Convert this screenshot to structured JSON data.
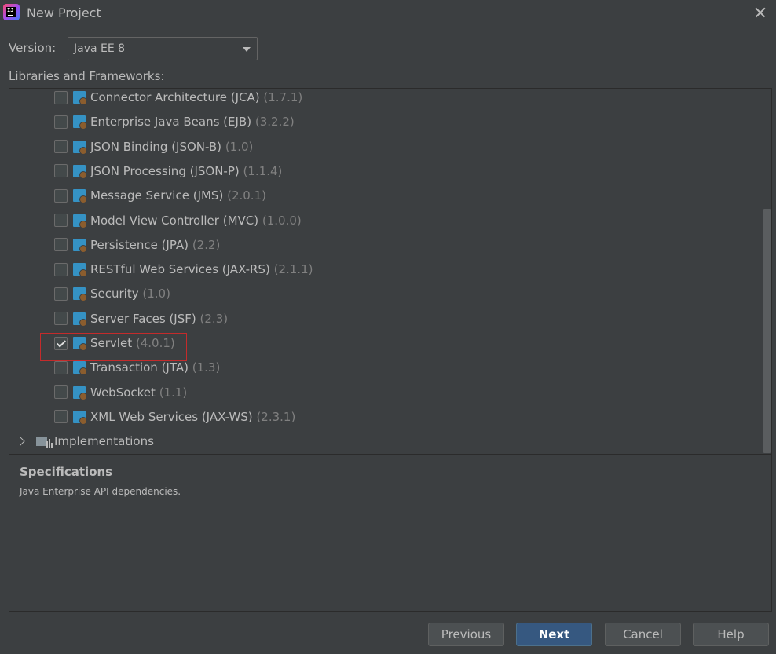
{
  "window": {
    "title": "New Project",
    "app_icon": "intellij-idea-icon",
    "close_icon": "close-icon"
  },
  "version": {
    "label": "Version:",
    "selected": "Java EE 8"
  },
  "libraries_label": "Libraries and Frameworks:",
  "libraries": [
    {
      "name": "Connector Architecture (JCA)",
      "version": "(1.7.1)",
      "checked": false
    },
    {
      "name": "Enterprise Java Beans (EJB)",
      "version": "(3.2.2)",
      "checked": false
    },
    {
      "name": "JSON Binding (JSON-B)",
      "version": "(1.0)",
      "checked": false
    },
    {
      "name": "JSON Processing (JSON-P)",
      "version": "(1.1.4)",
      "checked": false
    },
    {
      "name": "Message Service (JMS)",
      "version": "(2.0.1)",
      "checked": false
    },
    {
      "name": "Model View Controller (MVC)",
      "version": "(1.0.0)",
      "checked": false
    },
    {
      "name": "Persistence (JPA)",
      "version": "(2.2)",
      "checked": false
    },
    {
      "name": "RESTful Web Services (JAX-RS)",
      "version": "(2.1.1)",
      "checked": false
    },
    {
      "name": "Security",
      "version": "(1.0)",
      "checked": false
    },
    {
      "name": "Server Faces (JSF)",
      "version": "(2.3)",
      "checked": false
    },
    {
      "name": "Servlet",
      "version": "(4.0.1)",
      "checked": true
    },
    {
      "name": "Transaction (JTA)",
      "version": "(1.3)",
      "checked": false
    },
    {
      "name": "WebSocket",
      "version": "(1.1)",
      "checked": false
    },
    {
      "name": "XML Web Services (JAX-WS)",
      "version": "(2.3.1)",
      "checked": false
    }
  ],
  "implementations": {
    "label": "Implementations",
    "expanded": false
  },
  "specifications": {
    "title": "Specifications",
    "description": "Java Enterprise API dependencies."
  },
  "buttons": {
    "previous": "Previous",
    "next": "Next",
    "cancel": "Cancel",
    "help": "Help"
  },
  "colors": {
    "background": "#3c3f41",
    "text": "#bbbbbb",
    "version_text": "#808080",
    "primary_button": "#365880",
    "highlight_border": "#c42b2b",
    "library_icon": "#3592c4"
  }
}
